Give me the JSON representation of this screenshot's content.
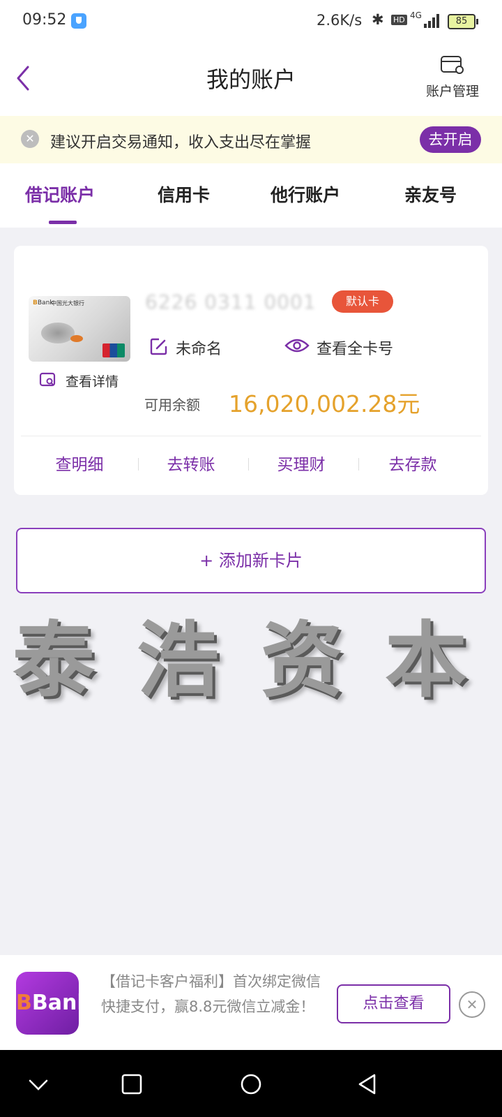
{
  "status_bar": {
    "time": "09:52",
    "speed": "2.6K/s",
    "hd": "HD",
    "network": "4G",
    "battery": "85"
  },
  "header": {
    "title": "我的账户",
    "manage_label": "账户管理"
  },
  "notice": {
    "text": "建议开启交易通知，收入支出尽在掌握",
    "button": "去开启"
  },
  "tabs": [
    "借记账户",
    "信用卡",
    "他行账户",
    "亲友号"
  ],
  "active_tab": 0,
  "account_card": {
    "card_bank_logo": "Bank",
    "card_bank_name": "中国光大银行",
    "card_number_masked": "6226 0311 0001",
    "default_tag": "默认卡",
    "rename_label": "未命名",
    "view_number_label": "查看全卡号",
    "detail_label": "查看详情",
    "available_label": "可用余额",
    "balance": "16,020,002.28元",
    "actions": [
      "查明细",
      "去转账",
      "买理财",
      "去存款"
    ]
  },
  "add_card_label": "+ 添加新卡片",
  "watermark": [
    "泰",
    "浩",
    "资",
    "本"
  ],
  "promo": {
    "logo_text": "Bank",
    "text": "【借记卡客户福利】首次绑定微信快捷支付，赢8.8元微信立减金！",
    "button": "点击查看"
  },
  "colors": {
    "brand": "#7b2fa8",
    "balance": "#e5a22c",
    "default_tag": "#e8553a",
    "notice_bg": "#fdfbe4"
  }
}
